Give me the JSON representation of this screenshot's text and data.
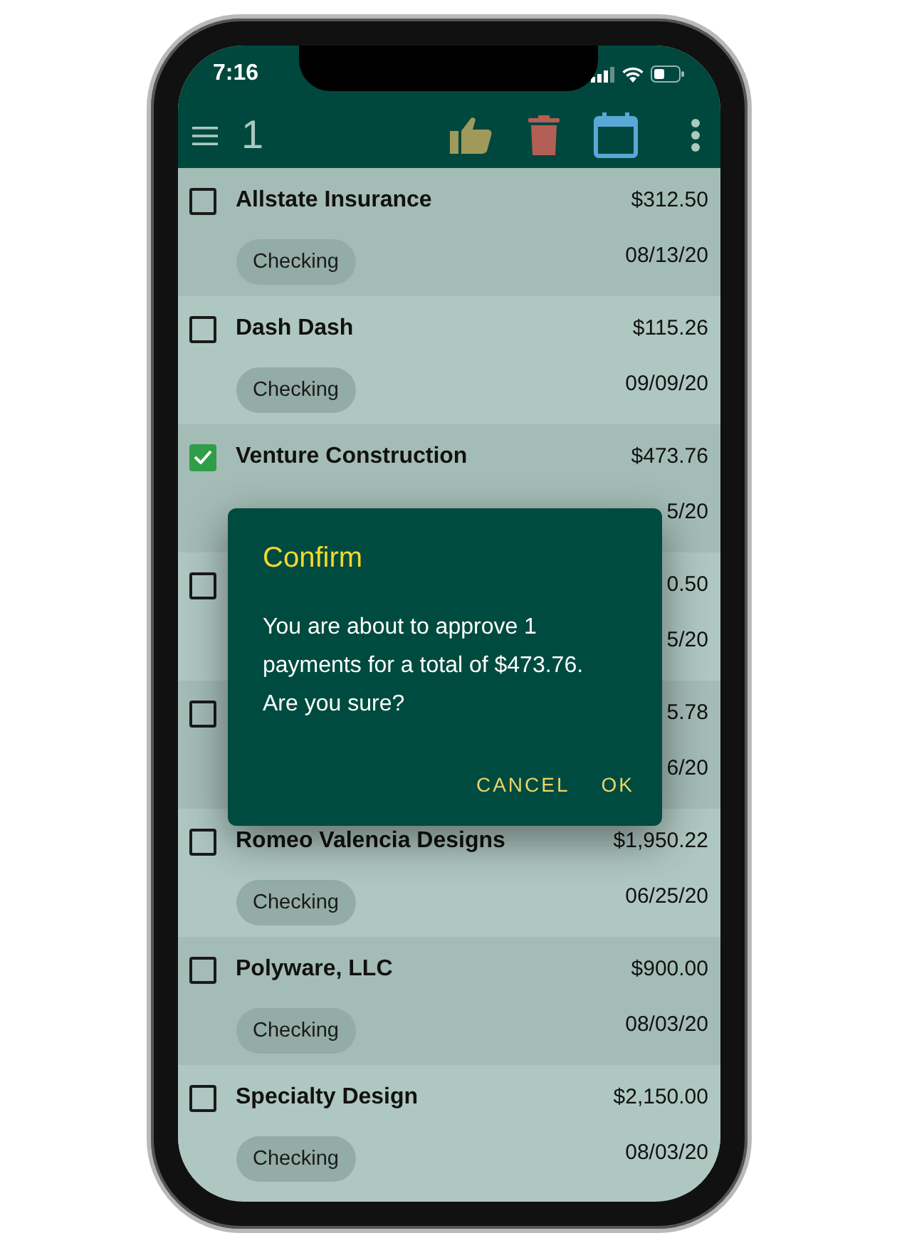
{
  "status_bar": {
    "time": "7:16"
  },
  "app_bar": {
    "selected_count": "1"
  },
  "payments": [
    {
      "checked": false,
      "payee": "Allstate Insurance",
      "amount": "$312.50",
      "account": "Checking",
      "date": "08/13/20"
    },
    {
      "checked": false,
      "payee": "Dash Dash",
      "amount": "$115.26",
      "account": "Checking",
      "date": "09/09/20"
    },
    {
      "checked": true,
      "payee": "Venture Construction",
      "amount": "$473.76",
      "date": "5/20"
    },
    {
      "checked": false,
      "amount": "0.50",
      "date": "5/20"
    },
    {
      "checked": false,
      "amount": "5.78",
      "date": "6/20"
    },
    {
      "checked": false,
      "payee": "Romeo Valencia Designs",
      "amount": "$1,950.22",
      "account": "Checking",
      "date": "06/25/20"
    },
    {
      "checked": false,
      "payee": "Polyware, LLC",
      "amount": "$900.00",
      "account": "Checking",
      "date": "08/03/20"
    },
    {
      "checked": false,
      "payee": "Specialty Design",
      "amount": "$2,150.00",
      "account": "Checking",
      "date": "08/03/20"
    }
  ],
  "dialog": {
    "title": "Confirm",
    "message": "You are about to approve 1 payments for a total of $473.76. Are you sure?",
    "actions": [
      "CANCEL",
      "OK"
    ]
  }
}
